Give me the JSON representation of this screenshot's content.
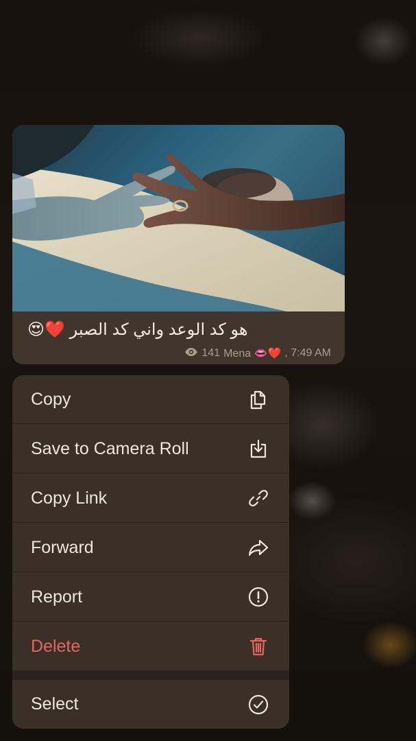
{
  "message": {
    "caption": "هو كد الوعد واني كد الصبر ❤️😍",
    "views": "141",
    "signature": "Mena 👄❤️",
    "time": ", 7:49 AM",
    "photo_description": "hands-reaching-photo"
  },
  "context_menu": {
    "items": [
      {
        "label": "Copy",
        "icon": "copy-icon"
      },
      {
        "label": "Save to Camera Roll",
        "icon": "save-download-icon"
      },
      {
        "label": "Copy Link",
        "icon": "link-icon"
      },
      {
        "label": "Forward",
        "icon": "forward-arrow-icon"
      },
      {
        "label": "Report",
        "icon": "report-exclamation-icon"
      },
      {
        "label": "Delete",
        "icon": "trash-icon",
        "color": "#e8655f"
      },
      {
        "label": "Select",
        "icon": "checkmark-circle-icon"
      }
    ]
  },
  "colors": {
    "menu_background": "#3a3028",
    "bubble_background": "#40362b",
    "destructive": "#e8655f",
    "text": "#ede7df"
  }
}
